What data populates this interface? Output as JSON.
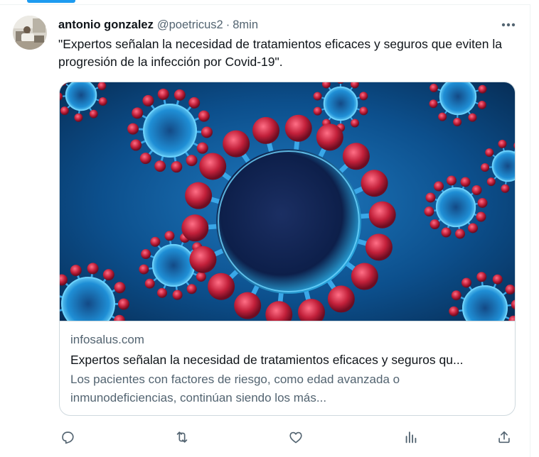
{
  "tweet": {
    "display_name": "antonio gonzalez",
    "handle": "@poetricus2",
    "separator": "·",
    "time": "8min",
    "text": "\"Expertos señalan la necesidad de tratamientos eficaces y seguros que eviten la progresión de la infección por Covid-19\"."
  },
  "card": {
    "domain": "infosalus.com",
    "title": "Expertos señalan la necesidad de tratamientos eficaces y seguros qu...",
    "description": "Los pacientes con factores de riesgo, como edad avanzada o inmunodeficiencias, continúan siendo los más..."
  },
  "actions": {
    "icons": [
      "reply-icon",
      "retweet-icon",
      "like-icon",
      "views-icon",
      "share-icon"
    ]
  },
  "colors": {
    "accent": "#1d9bf0",
    "text_primary": "#0f1419",
    "text_secondary": "#536471",
    "border": "#cfd9de",
    "virus_spike": "#c2203a",
    "image_background": "#0a4a80"
  }
}
